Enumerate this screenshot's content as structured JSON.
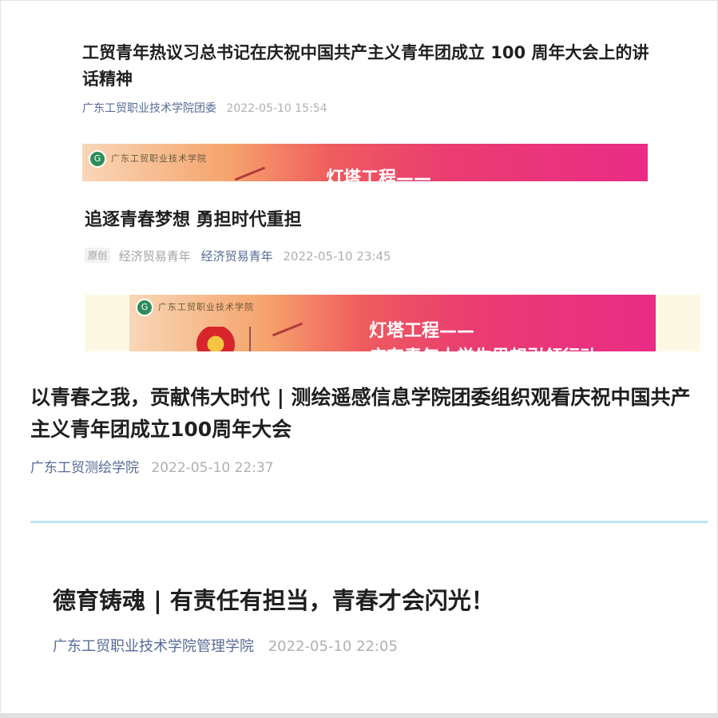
{
  "articles": [
    {
      "title": "工贸青年热议习总书记在庆祝中国共产主义青年团成立 100 周年大会上的讲话精神",
      "source": "广东工贸职业技术学院团委",
      "date": "2022-05-10 15:54"
    },
    {
      "title": "追逐青春梦想 勇担时代重担",
      "badge": "原创",
      "account": "经济贸易青年",
      "source": "经济贸易青年",
      "date": "2022-05-10 23:45"
    },
    {
      "title": "以青春之我，贡献伟大时代 | 测绘遥感信息学院团委组织观看庆祝中国共产主义青年团成立100周年大会",
      "source": "广东工贸测绘学院",
      "date": "2022-05-10 22:37"
    },
    {
      "title": "德育铸魂 | 有责任有担当，青春才会闪光！",
      "source": "广东工贸职业技术学院管理学院",
      "date": "2022-05-10 22:05"
    }
  ],
  "banners": [
    {
      "school_name": "广东工贸职业技术学院",
      "headline": "灯塔工程——"
    },
    {
      "school_name": "广东工贸职业技术学院",
      "headline": "灯塔工程——",
      "subline": "广东青年大学生思想引领行动"
    }
  ],
  "colors": {
    "source_link": "#576b95",
    "divider_blue": "#bfe3f5",
    "banner_start": "#f8d7b7",
    "banner_end": "#e92c86"
  }
}
